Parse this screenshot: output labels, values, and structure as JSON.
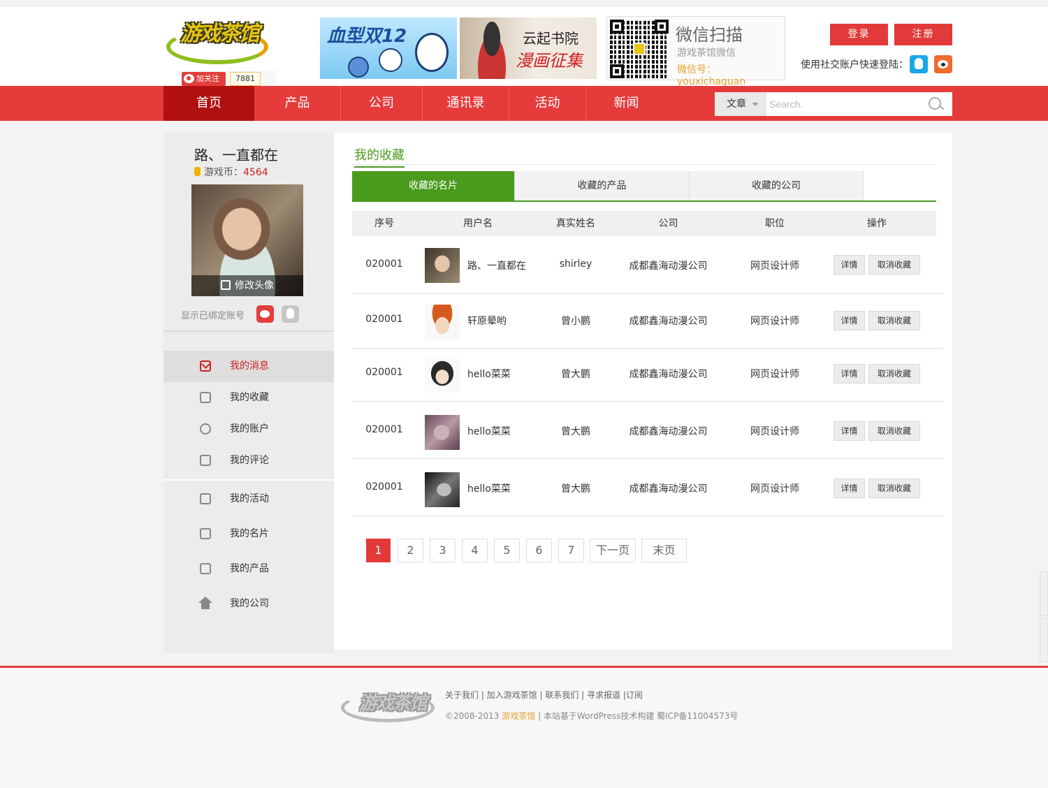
{
  "header": {
    "logo_text": "游戏茶馆",
    "follow_label": "加关注",
    "follow_count": "7881",
    "banner1_text": "血型双12",
    "banner2_title": "云起书院",
    "banner2_subtitle": "漫画征集",
    "wechat_title": "微信扫描",
    "wechat_subtitle": "游戏茶馆微信",
    "wechat_account": "微信号：youxichaguan",
    "login_label": "登录",
    "register_label": "注册",
    "social_login_text": "使用社交账户快速登陆："
  },
  "nav": {
    "items": [
      "首页",
      "产品",
      "公司",
      "通讯录",
      "活动",
      "新闻"
    ],
    "active_index": 0,
    "search_category": "文章",
    "search_placeholder": "Search."
  },
  "sidebar": {
    "user_name": "路、一直都在",
    "coin_label": "游戏币：",
    "coin_value": "4564",
    "edit_avatar_label": "修改头像",
    "bound_accounts_label": "显示已绑定账号",
    "menu": [
      {
        "label": "我的消息",
        "icon": "mail-icon",
        "active": true
      },
      {
        "label": "我的收藏",
        "icon": "folder-icon"
      },
      {
        "label": "我的账户",
        "icon": "users-icon"
      },
      {
        "label": "我的评论",
        "icon": "comment-icon"
      },
      {
        "label": "我的活动",
        "icon": "activity-icon"
      },
      {
        "label": "我的名片",
        "icon": "card-icon"
      },
      {
        "label": "我的产品",
        "icon": "product-icon"
      },
      {
        "label": "我的公司",
        "icon": "home-icon"
      }
    ]
  },
  "main": {
    "title": "我的收藏",
    "tabs": [
      "收藏的名片",
      "收藏的产品",
      "收藏的公司"
    ],
    "active_tab": 0,
    "columns": [
      "序号",
      "用户名",
      "真实姓名",
      "公司",
      "职位",
      "操作"
    ],
    "rows": [
      {
        "sn": "020001",
        "username": "路、一直都在",
        "real_name": "shirley",
        "company": "成都鑫海动漫公司",
        "position": "网页设计师"
      },
      {
        "sn": "020001",
        "username": "轩原晕哟",
        "real_name": "曾小鹏",
        "company": "成都鑫海动漫公司",
        "position": "网页设计师"
      },
      {
        "sn": "020001",
        "username": "hello菜菜",
        "real_name": "曾大鹏",
        "company": "成都鑫海动漫公司",
        "position": "网页设计师"
      },
      {
        "sn": "020001",
        "username": "hello菜菜",
        "real_name": "曾大鹏",
        "company": "成都鑫海动漫公司",
        "position": "网页设计师"
      },
      {
        "sn": "020001",
        "username": "hello菜菜",
        "real_name": "曾大鹏",
        "company": "成都鑫海动漫公司",
        "position": "网页设计师"
      }
    ],
    "detail_label": "详情",
    "cancel_label": "取消收藏",
    "pagination": {
      "pages": [
        "1",
        "2",
        "3",
        "4",
        "5",
        "6",
        "7"
      ],
      "current": "1",
      "next_label": "下一页",
      "last_label": "末页"
    }
  },
  "footer": {
    "links": "关于我们 | 加入游戏茶馆 | 联系我们 | 寻求报道 |订阅",
    "copyright_prefix": "©2008-2013 ",
    "copyright_brand": "游戏茶馆",
    "copyright_suffix": " | 本站基于WordPress技术构建    蜀ICP备11004573号"
  },
  "colors": {
    "brand_red": "#e53b3b",
    "nav_active": "#b01010",
    "accent_green": "#4a9a1e"
  }
}
